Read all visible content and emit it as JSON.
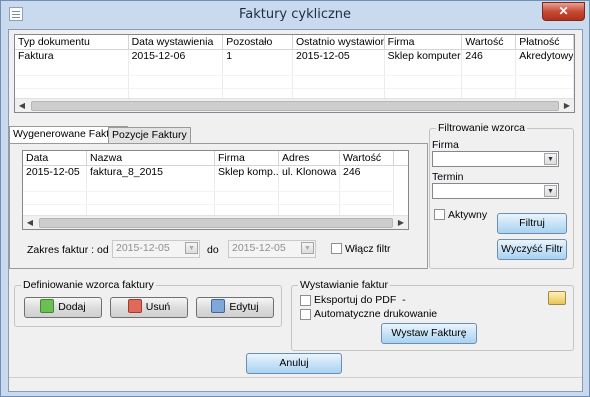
{
  "window": {
    "title": "Faktury cykliczne",
    "close_label": "✕"
  },
  "top_grid": {
    "columns": [
      "Typ dokumentu",
      "Data wystawienia",
      "Pozostało",
      "Ostatnio wystawiona",
      "Firma",
      "Wartość",
      "Płatność"
    ],
    "rows": [
      [
        "Faktura",
        "2015-12-06",
        "1",
        "2015-12-05",
        "Sklep komputer...",
        "246",
        "Akredytowy"
      ]
    ]
  },
  "tabs": [
    {
      "label": "Wygenerowane Faktury",
      "active": true
    },
    {
      "label": "Pozycje Faktury",
      "active": false
    }
  ],
  "invoice_grid": {
    "columns": [
      "Data",
      "Nazwa",
      "Firma",
      "Adres",
      "Wartość"
    ],
    "rows": [
      [
        "2015-12-05",
        "faktura_8_2015",
        "Sklep komp...",
        "ul. Klonowa ...",
        "246"
      ]
    ]
  },
  "date_range": {
    "label_from": "Zakres faktur : od",
    "from_value": "2015-12-05",
    "label_to": "do",
    "to_value": "2015-12-05",
    "filter_label": "Włącz filtr"
  },
  "filter_group": {
    "title": "Filtrowanie wzorca",
    "firma_label": "Firma",
    "firma_value": "",
    "termin_label": "Termin",
    "termin_value": "",
    "active_label": "Aktywny",
    "filter_button": "Filtruj",
    "clear_button": "Wyczyść Filtr"
  },
  "template_group": {
    "title": "Definiowanie wzorca faktury",
    "add_button": "Dodaj",
    "delete_button": "Usuń",
    "edit_button": "Edytuj"
  },
  "issue_group": {
    "title": "Wystawianie faktur",
    "export_pdf_label": "Eksportuj do PDF",
    "export_pdf_suffix": "-",
    "auto_print_label": "Automatyczne drukowanie",
    "issue_button": "Wystaw Fakturę"
  },
  "footer": {
    "cancel_button": "Anuluj"
  }
}
